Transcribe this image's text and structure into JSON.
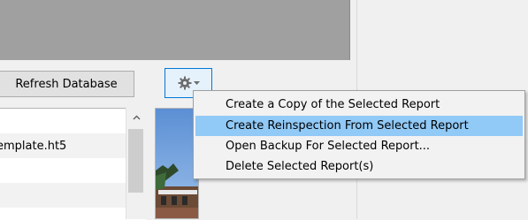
{
  "toolbar": {
    "refresh_label": "Refresh Database",
    "gear_icon": "gear-icon",
    "dropdown_icon": "caret-down-icon"
  },
  "list": {
    "rows": [
      {
        "text": ""
      },
      {
        "text": "emplate.ht5"
      },
      {
        "text": ""
      },
      {
        "text": ""
      }
    ]
  },
  "context_menu": {
    "items": [
      {
        "label": "Create a Copy of the Selected Report",
        "highlighted": false
      },
      {
        "label": "Create Reinspection From Selected Report",
        "highlighted": true
      },
      {
        "label": "Open Backup For Selected Report...",
        "highlighted": false
      },
      {
        "label": "Delete Selected Report(s)",
        "highlighted": false
      }
    ]
  },
  "colors": {
    "menu_highlight": "#91c9f7",
    "gear_button_border": "#0078d7",
    "top_panel": "#a0a0a0"
  }
}
